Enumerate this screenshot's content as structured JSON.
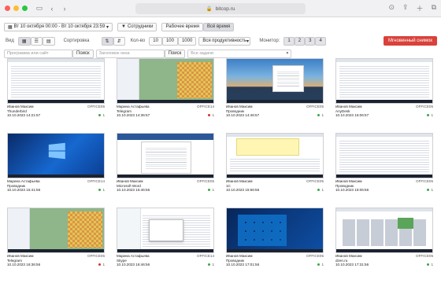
{
  "browser": {
    "url": "bitcop.ru"
  },
  "toolbar": {
    "date_range": "Вт 10 октября 00:00 - Вт 10 октября 23:59",
    "employees_label": "Сотрудники",
    "work_time_label": "Рабочее время",
    "all_time_label": "Всё время",
    "view_label": "Вид",
    "sort_label": "Сортировка",
    "count_label": "Кол-во",
    "count_options": [
      "10",
      "100",
      "1000"
    ],
    "productivity_label": "Вся продуктивность",
    "monitor_label": "Монитор:",
    "monitors": [
      "1",
      "2",
      "3",
      "4"
    ],
    "instant_snapshot_label": "Мгновенный снимок",
    "program_placeholder": "Программа или сайт",
    "search_label": "Поиск",
    "window_title_placeholder": "Заголовок окна",
    "tasks_placeholder": "Все задачи"
  },
  "colors": {
    "accent_red": "#d9413a",
    "status_green": "#3aa845",
    "status_red": "#d0342c"
  },
  "cards": [
    {
      "user": "Иванов Максим",
      "pc": "OFFICE05",
      "app": "Thunderbird",
      "time": "10.10.2023 14:21:57",
      "status": "green",
      "count": "1",
      "art": "rows"
    },
    {
      "user": "Марина Астафьева",
      "pc": "OFFICE14",
      "app": "Telegram",
      "time": "10.10.2023 14:36:57",
      "status": "red",
      "count": "1",
      "art": "telegram"
    },
    {
      "user": "Иванов Максим",
      "pc": "OFFICE05",
      "app": "Проводник",
      "time": "10.10.2023 14:46:57",
      "status": "green",
      "count": "1",
      "art": "sunset"
    },
    {
      "user": "Иванов Максим",
      "pc": "OFFICE05",
      "app": "AnyDesk",
      "time": "10.10.2023 15:06:57",
      "status": "green",
      "count": "1",
      "art": "rows"
    },
    {
      "user": "Марина Астафьева",
      "pc": "OFFICE14",
      "app": "Проводник",
      "time": "10.10.2023 15:41:56",
      "status": "green",
      "count": "1",
      "art": "windows"
    },
    {
      "user": "Иванов Максим",
      "pc": "OFFICE05",
      "app": "Microsoft Word",
      "time": "10.10.2023 15:46:56",
      "status": "green",
      "count": "1",
      "art": "word"
    },
    {
      "user": "Иванов Максим",
      "pc": "OFFICE05",
      "app": "1С",
      "time": "10.10.2023 15:56:56",
      "status": "green",
      "count": "1",
      "art": "onec"
    },
    {
      "user": "Иванов Максим",
      "pc": "OFFICE05",
      "app": "Проводник",
      "time": "10.10.2023 16:06:56",
      "status": "green",
      "count": "1",
      "art": "rows"
    },
    {
      "user": "Иванов Максим",
      "pc": "OFFICE05",
      "app": "Telegram",
      "time": "10.10.2023 16:36:56",
      "status": "red",
      "count": "1",
      "art": "telegram"
    },
    {
      "user": "Марина Астафьева",
      "pc": "OFFICE14",
      "app": "Skype",
      "time": "10.10.2023 16:46:56",
      "status": "green",
      "count": "1",
      "art": "skype"
    },
    {
      "user": "Иванов Максим",
      "pc": "OFFICE05",
      "app": "Проводник",
      "time": "10.10.2023 17:01:56",
      "status": "green",
      "count": "1",
      "art": "start"
    },
    {
      "user": "Иванов Максим",
      "pc": "OFFICE05",
      "app": "dzen.ru",
      "time": "10.10.2023 17:31:56",
      "status": "green",
      "count": "1",
      "art": "web"
    }
  ]
}
